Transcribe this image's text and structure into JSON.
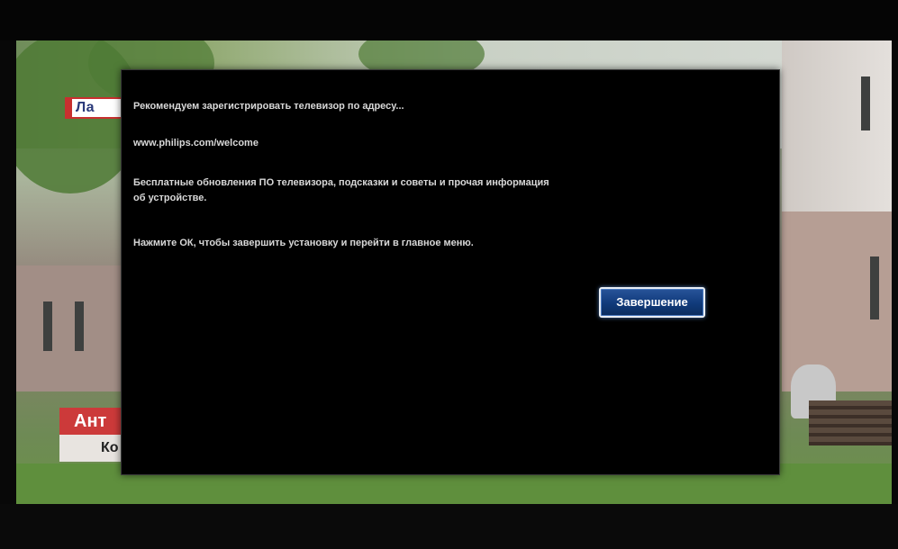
{
  "channel_overlay": {
    "logo_text": "Ла",
    "lower_third_line1": "Ант",
    "lower_third_line2": "Ко"
  },
  "dialog": {
    "line1": "Рекомендуем зарегистрировать телевизор по адресу...",
    "url": "www.philips.com/welcome",
    "line3a": "Бесплатные обновления ПО телевизора, подсказки и советы и прочая информация",
    "line3b": "об устройстве.",
    "line4": "Нажмите ОК, чтобы завершить установку и перейти в главное меню.",
    "finish_button_label": "Завершение"
  },
  "colors": {
    "dialog_background": "#000000",
    "button_blue": "#103a7a",
    "button_border": "#e9eef5",
    "channel_red": "#cc3a3a"
  }
}
